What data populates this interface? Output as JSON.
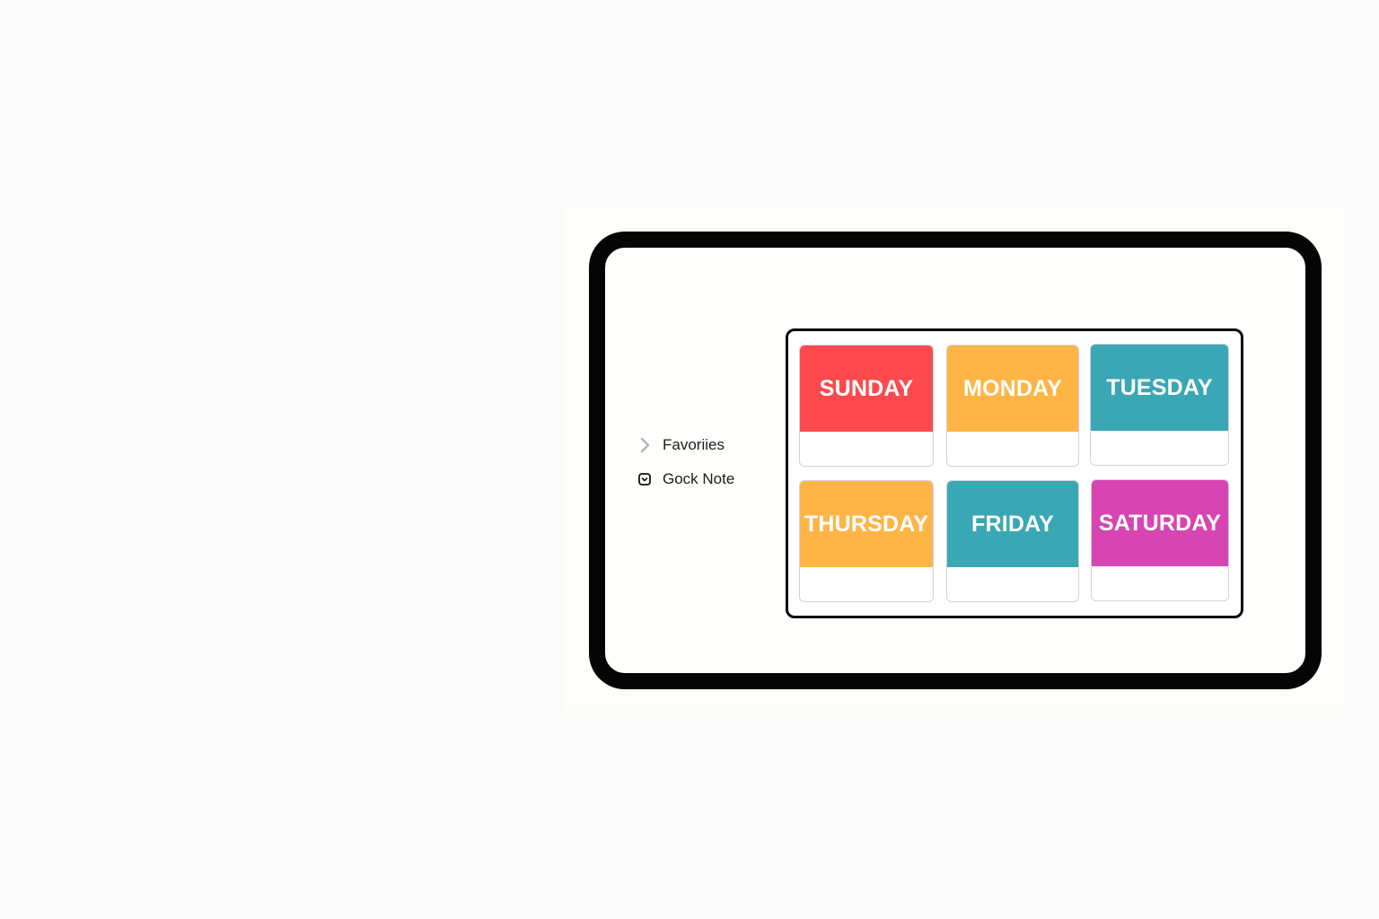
{
  "sidebar": {
    "items": [
      {
        "label": "Favoriies",
        "icon": "chevron-right-icon"
      },
      {
        "label": "Gock Note",
        "icon": "note-square-icon"
      }
    ]
  },
  "days": [
    {
      "label": "SUNDAY",
      "color": "#fd4a4e"
    },
    {
      "label": "MONDAY",
      "color": "#ffb546"
    },
    {
      "label": "TUESDAY",
      "color": "#3aa7b4"
    },
    {
      "label": "THURSDAY",
      "color": "#ffb546"
    },
    {
      "label": "FRIDAY",
      "color": "#3aa7b4"
    },
    {
      "label": "SATURDAY",
      "color": "#d645b1"
    }
  ]
}
